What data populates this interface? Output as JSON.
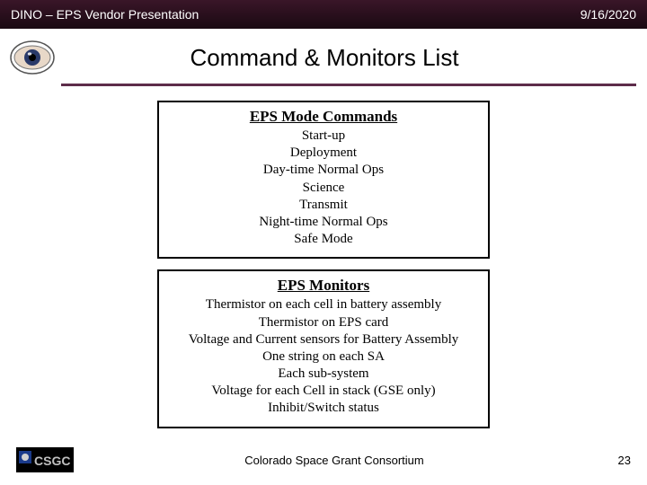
{
  "header": {
    "left": "DINO – EPS Vendor Presentation",
    "right": "9/16/2020"
  },
  "slide_title": "Command & Monitors List",
  "box1": {
    "title": "EPS Mode Commands",
    "lines": [
      "Start-up",
      "Deployment",
      "Day-time Normal Ops",
      "Science",
      "Transmit",
      "Night-time Normal Ops",
      "Safe Mode"
    ]
  },
  "box2": {
    "title": "EPS Monitors",
    "lines": [
      "Thermistor on each cell in battery assembly",
      "Thermistor on EPS card",
      "Voltage and Current sensors for Battery Assembly",
      "One string on each SA",
      "Each sub-system",
      "Voltage for each Cell in stack (GSE only)",
      "Inhibit/Switch status"
    ]
  },
  "footer": {
    "text": "Colorado Space Grant Consortium",
    "page": "23"
  }
}
